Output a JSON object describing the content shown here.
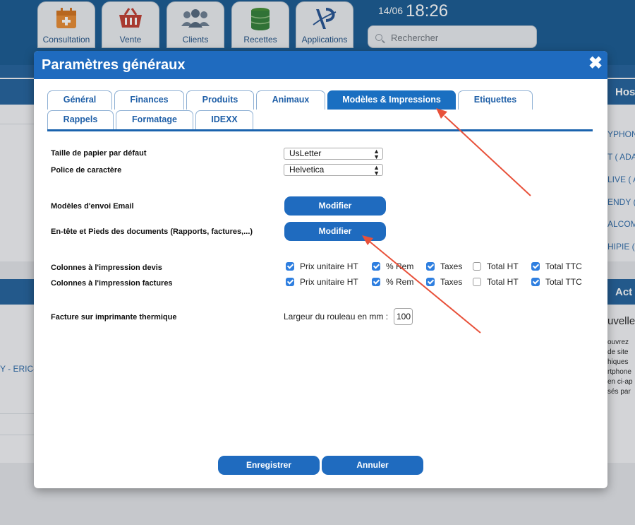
{
  "topbar": {
    "buttons": [
      {
        "label": "Consultation",
        "icon": "medical-calendar-icon"
      },
      {
        "label": "Vente",
        "icon": "basket-icon"
      },
      {
        "label": "Clients",
        "icon": "users-icon"
      },
      {
        "label": "Recettes",
        "icon": "coins-stack-icon"
      },
      {
        "label": "Applications",
        "icon": "app-logo-icon"
      }
    ],
    "date": "14/06",
    "time": "18:26",
    "search_placeholder": "Rechercher"
  },
  "background": {
    "right_header": "Hos",
    "right_list": [
      "YPHON",
      "T ( ADA",
      "LIVE ( A",
      "ENDY (",
      "ALCOM",
      "HIPIE ("
    ],
    "right_header2": "Act",
    "right_news_title": "uvelle",
    "right_news_lines": [
      "ouvrez",
      "de site",
      "hiques",
      "rtphone",
      "en ci-ap",
      "sés par"
    ],
    "left_text": "Y - ERIC-"
  },
  "modal": {
    "title": "Paramètres généraux",
    "close": "✖",
    "tabs_row1": [
      "Général",
      "Finances",
      "Produits",
      "Animaux",
      "Modèles & Impressions",
      "Etiquettes"
    ],
    "tabs_row2": [
      "Rappels",
      "Formatage",
      "IDEXX"
    ],
    "active_tab": "Modèles & Impressions",
    "paper_size": {
      "label": "Taille de papier par défaut",
      "value": "UsLetter"
    },
    "font": {
      "label": "Police de caractère",
      "value": "Helvetica"
    },
    "email_models": {
      "label": "Modèles d'envoi Email",
      "button": "Modifier"
    },
    "header_footer": {
      "label": "En-tête et Pieds des documents (Rapports, factures,...)",
      "button": "Modifier"
    },
    "columns_quote": {
      "label": "Colonnes à l'impression devis",
      "options": [
        {
          "label": "Prix unitaire HT",
          "checked": true
        },
        {
          "label": "% Rem",
          "checked": true
        },
        {
          "label": "Taxes",
          "checked": true
        },
        {
          "label": "Total HT",
          "checked": false
        },
        {
          "label": "Total TTC",
          "checked": true
        }
      ]
    },
    "columns_invoice": {
      "label": "Colonnes à l'impression factures",
      "options": [
        {
          "label": "Prix unitaire HT",
          "checked": true
        },
        {
          "label": "% Rem",
          "checked": true
        },
        {
          "label": "Taxes",
          "checked": true
        },
        {
          "label": "Total HT",
          "checked": false
        },
        {
          "label": "Total TTC",
          "checked": true
        }
      ]
    },
    "thermal": {
      "label": "Facture sur imprimante thermique",
      "roll_label": "Largeur du rouleau en mm :",
      "roll_value": "100"
    },
    "save_button": "Enregistrer",
    "cancel_button": "Annuler"
  },
  "annotation_color": "#e8513a"
}
